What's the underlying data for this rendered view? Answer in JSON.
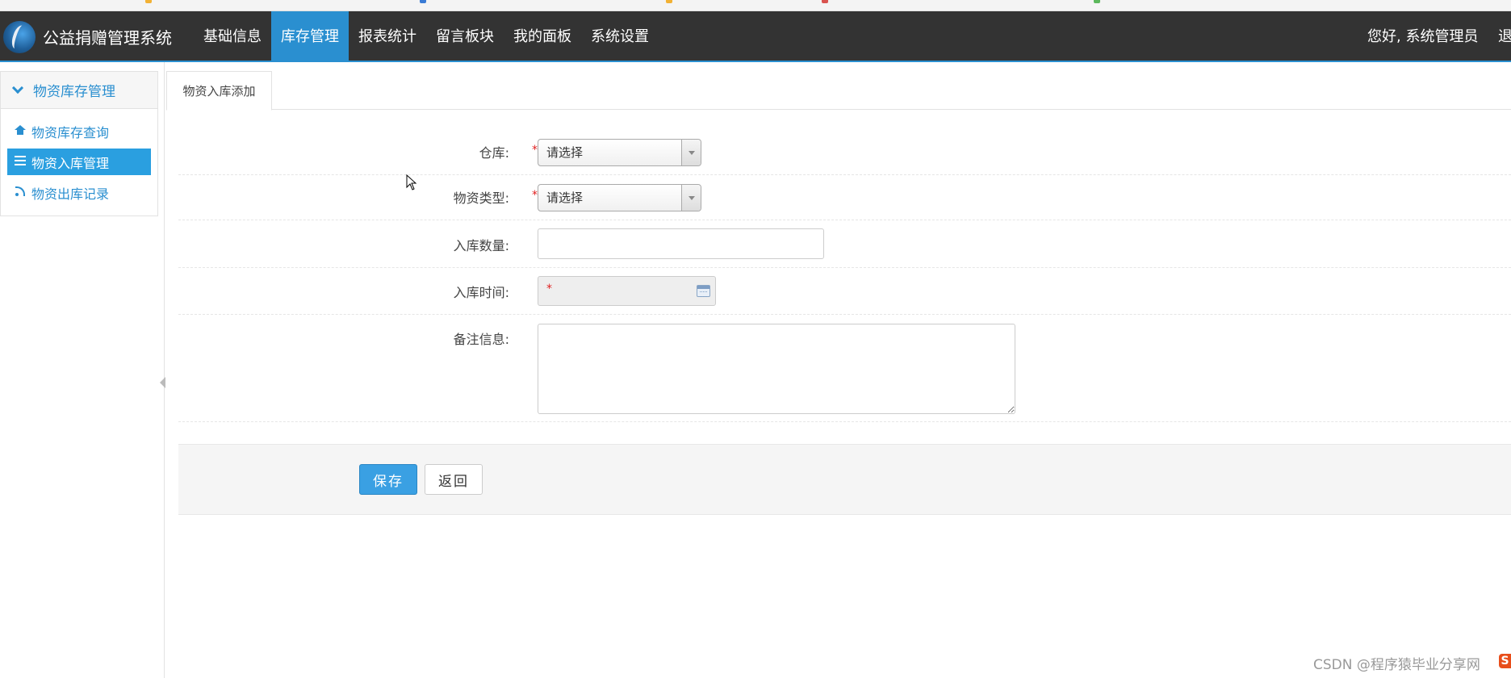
{
  "app": {
    "title": "公益捐赠管理系统",
    "nav": [
      "基础信息",
      "库存管理",
      "报表统计",
      "留言板块",
      "我的面板",
      "系统设置"
    ],
    "active_nav": "库存管理",
    "greeting": "您好, 系统管理员",
    "logout": "退"
  },
  "sidebar": {
    "section": "物资库存管理",
    "items": [
      {
        "label": "物资库存查询",
        "icon": "home-icon"
      },
      {
        "label": "物资入库管理",
        "icon": "list-icon"
      },
      {
        "label": "物资出库记录",
        "icon": "rss-icon"
      }
    ],
    "active": "物资入库管理"
  },
  "tab": {
    "label": "物资入库添加"
  },
  "form": {
    "warehouse": {
      "label": "仓库:",
      "value": "请选择",
      "required": "*"
    },
    "material_type": {
      "label": "物资类型:",
      "value": "请选择",
      "required": "*"
    },
    "quantity": {
      "label": "入库数量:",
      "value": ""
    },
    "time": {
      "label": "入库时间:",
      "value": "",
      "required": "*"
    },
    "remark": {
      "label": "备注信息:",
      "value": ""
    }
  },
  "actions": {
    "save": "保存",
    "back": "返回"
  },
  "watermark": "CSDN @程序猿毕业分享网",
  "colors": {
    "header_bg": "#333333",
    "accent": "#2a8fd0",
    "required": "#e02020"
  }
}
